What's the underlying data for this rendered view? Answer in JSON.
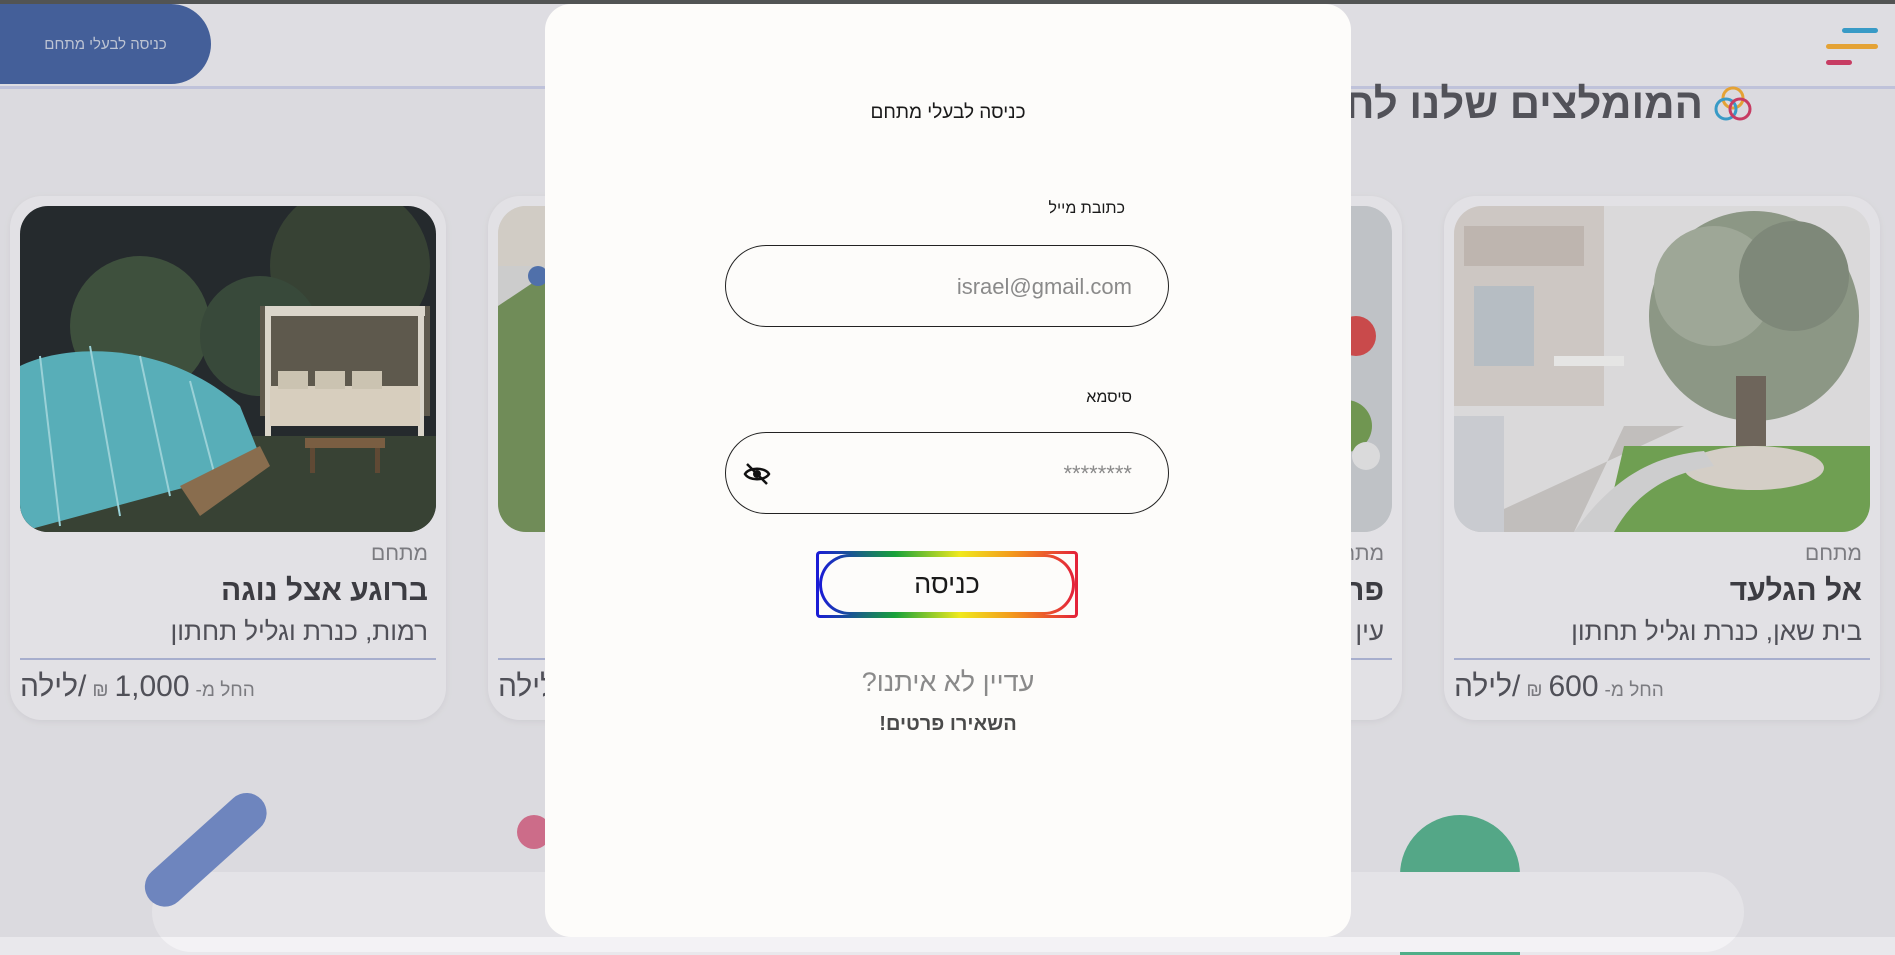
{
  "header": {
    "owner_login_button": "כניסה לבעלי מתחם",
    "menu_colors": [
      "#2f9fd0",
      "#f3a82b",
      "#d2345f"
    ]
  },
  "section": {
    "title": "המומלצים שלנו לחו"
  },
  "cards": [
    {
      "kind": "מתחם",
      "name": "אל הגלעד",
      "region": "בית שאן, כנרת וגליל תחתון",
      "price_from": "החל מ-",
      "price": "600",
      "currency": "₪",
      "unit": "/לילה"
    },
    {
      "kind": "מתח",
      "name": "פר",
      "region": "עין"
    },
    {
      "kind": "",
      "name": "",
      "region": "",
      "unit": "לילה"
    },
    {
      "kind": "מתחם",
      "name": "ברוגע אצל נוגה",
      "region": "רמות, כנרת וגליל תחתון",
      "price_from": "החל מ-",
      "price": "1,000",
      "currency": "₪",
      "unit": "/לילה"
    }
  ],
  "modal": {
    "title": "כניסה לבעלי מתחם",
    "email_label": "כתובת מייל",
    "email_placeholder": "israel@gmail.com",
    "password_label": "סיסמא",
    "password_placeholder": "********",
    "login_button": "כניסה",
    "not_registered": "עדיין לא איתנו?",
    "leave_details": "השאירו פרטים!"
  }
}
